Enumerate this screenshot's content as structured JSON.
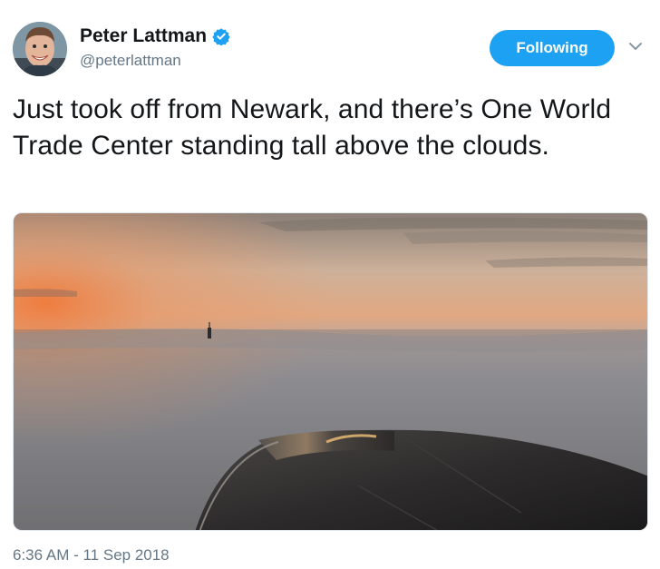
{
  "user": {
    "display_name": "Peter Lattman",
    "handle": "@peterlattman",
    "verified": true,
    "avatar_icon": "person-avatar"
  },
  "actions": {
    "follow_label": "Following",
    "more_icon": "chevron-down-icon"
  },
  "tweet": {
    "text": "Just took off from Newark, and there’s One World Trade Center standing tall above the clouds.",
    "media_description_icon": "photo",
    "timestamp": "6:36 AM - 11 Sep 2018"
  },
  "colors": {
    "accent": "#1da1f2",
    "text_primary": "#14171a",
    "text_secondary": "#657786"
  }
}
